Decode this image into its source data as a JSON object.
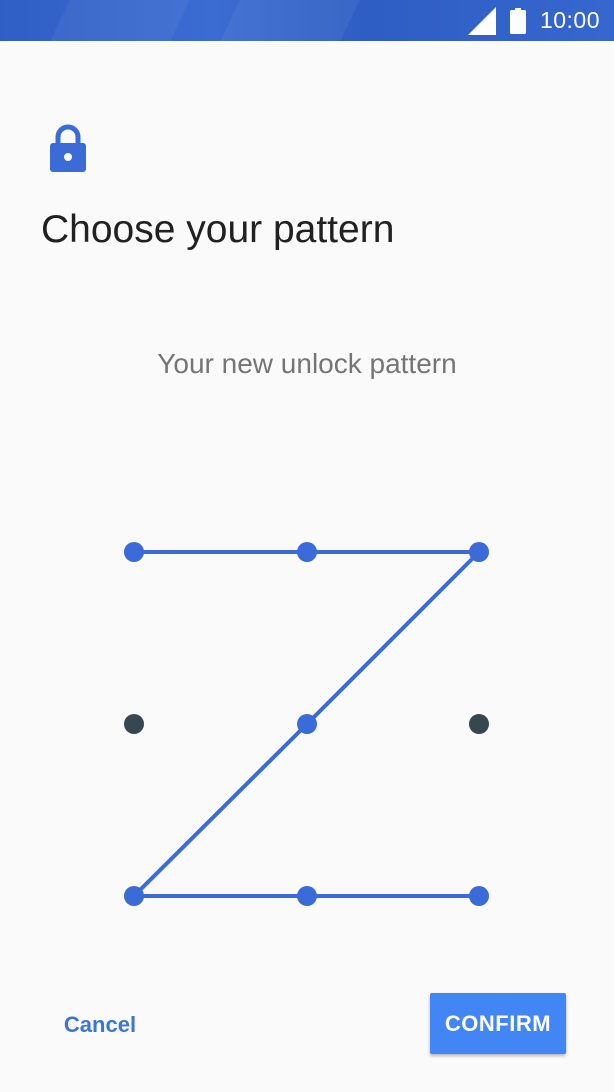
{
  "status_bar": {
    "time": "10:00",
    "signal_icon": "signal-icon",
    "battery_icon": "battery-icon"
  },
  "header": {
    "icon": "lock-icon",
    "title": "Choose your pattern"
  },
  "pattern": {
    "subtitle": "Your new unlock pattern",
    "grid_size": 3,
    "sequence": [
      1,
      2,
      3,
      5,
      7,
      8,
      9
    ],
    "active_color": "#3a6bd8",
    "inactive_color": "#37474f"
  },
  "actions": {
    "cancel_label": "Cancel",
    "confirm_label": "CONFIRM"
  },
  "colors": {
    "accent": "#4285f4",
    "status_bar": "#3366cc",
    "link": "#3d75d6"
  }
}
